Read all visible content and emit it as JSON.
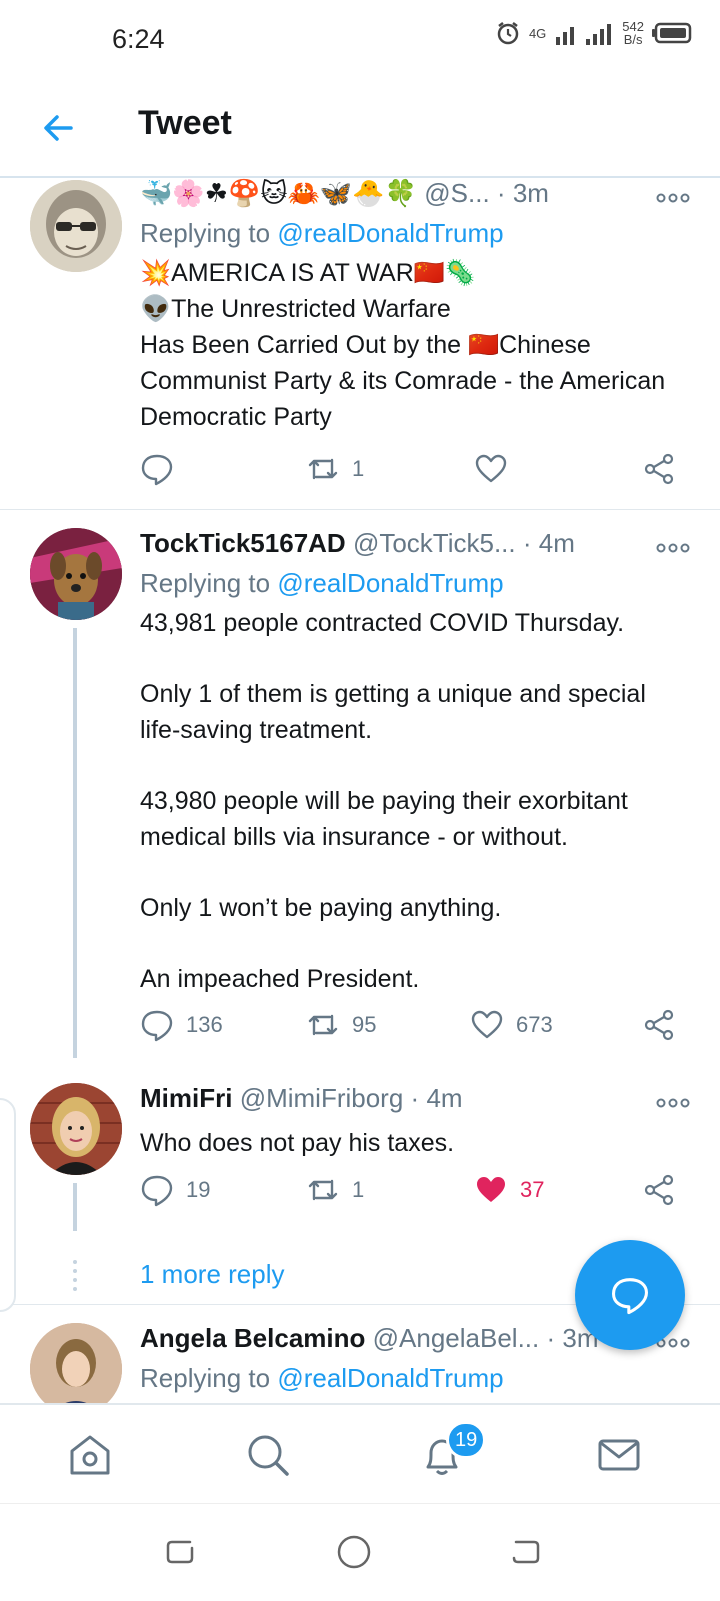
{
  "status_bar": {
    "time": "6:24",
    "network_rate": "542",
    "network_unit": "B/s",
    "network_type": "4G"
  },
  "header": {
    "title": "Tweet",
    "back_icon": "arrow-left-icon"
  },
  "tweets": [
    {
      "emojis": "🐳🌸☘🍄🐱🦀🦋🐣🍀",
      "handle": "@S...",
      "dot": "·",
      "time": "3m",
      "reply_prefix": "Replying to",
      "reply_mention": "@realDonaldTrump",
      "lines": [
        "💥AMERICA IS AT WAR🇨🇳🦠",
        "👽The Unrestricted Warfare",
        "Has Been Carried Out by the 🇨🇳Chinese Communist Party & its Comrade - the American Democratic Party"
      ],
      "replies": "",
      "retweets": "1",
      "likes": ""
    },
    {
      "name": "TockTick5167AD",
      "handle": "@TockTick5...",
      "dot": "·",
      "time": "4m",
      "reply_prefix": "Replying to",
      "reply_mention": "@realDonaldTrump",
      "paragraphs": [
        "43,981 people contracted COVID Thursday.",
        "Only 1 of them is getting a unique and special life-saving treatment.",
        "43,980 people will be paying their exorbitant medical bills via insurance - or without.",
        "Only 1 won’t be paying anything.",
        "An impeached President."
      ],
      "replies": "136",
      "retweets": "95",
      "likes": "673"
    },
    {
      "name": "MimiFri",
      "handle": "@MimiFriborg",
      "dot": "·",
      "time": "4m",
      "text": "Who does not pay his taxes.",
      "replies": "19",
      "retweets": "1",
      "likes": "37",
      "liked": true
    },
    {
      "name": "Angela Belcamino",
      "handle": "@AngelaBel...",
      "dot": "·",
      "time": "3m",
      "reply_prefix": "Replying to",
      "reply_mention": "@realDonaldTrump"
    }
  ],
  "more_replies": "1 more reply",
  "bottom_nav": {
    "items": [
      "home-icon",
      "search-icon",
      "notifications-icon",
      "messages-icon"
    ],
    "notification_count": "19"
  },
  "colors": {
    "accent": "#1d9bf0",
    "like": "#e0245e",
    "muted": "#657786",
    "text": "#14171a"
  }
}
